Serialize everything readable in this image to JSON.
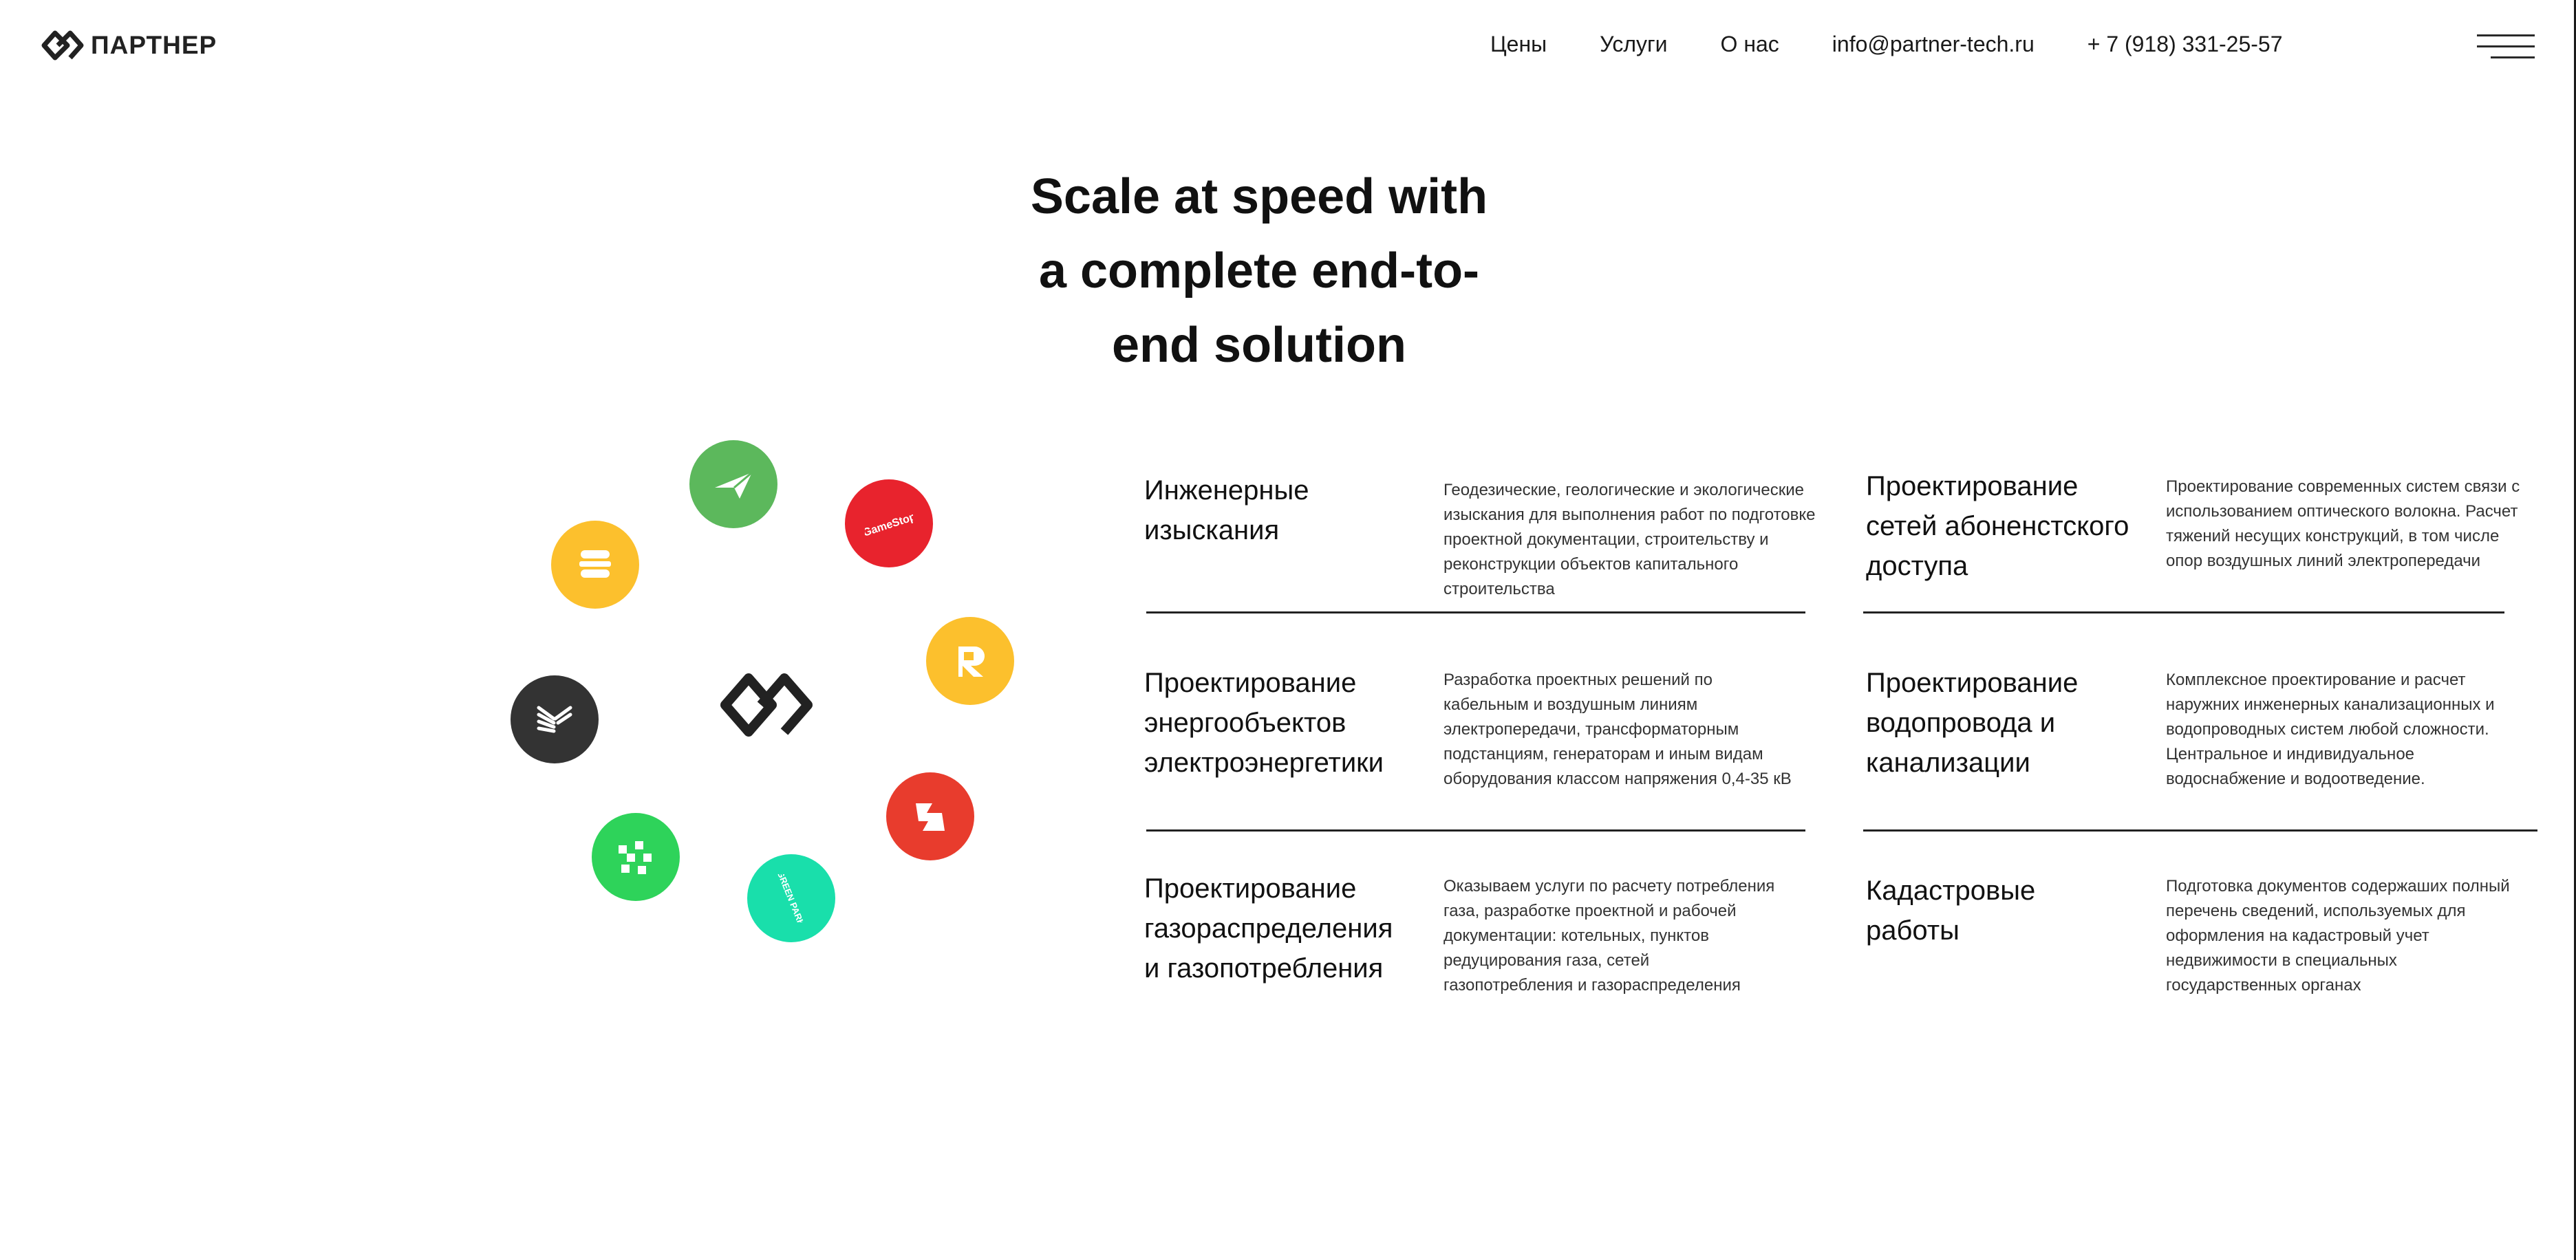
{
  "brand": {
    "name": "ПАРТНЕР"
  },
  "nav": {
    "items": [
      "Цены",
      "Услуги",
      "О нас",
      "info@partner-tech.ru",
      "+ 7 (918) 331-25-57"
    ]
  },
  "hero": {
    "lines": [
      "Scale at speed with",
      "a complete end-to-",
      "end solution"
    ]
  },
  "orbit": {
    "circles": [
      {
        "icon": "paper-plane-icon",
        "color": "#5cb85c"
      },
      {
        "icon": "gamestop-logo-icon",
        "color": "#e8232d",
        "text": "GameStop"
      },
      {
        "icon": "burger-logo-icon",
        "color": "#fcc02d"
      },
      {
        "icon": "r-logo-icon",
        "color": "#fcc02d"
      },
      {
        "icon": "wing-logo-icon",
        "color": "#333333"
      },
      {
        "icon": "m-logo-icon",
        "color": "#e83c2d"
      },
      {
        "icon": "checker-logo-icon",
        "color": "#2ed35a"
      },
      {
        "icon": "green-park-logo-icon",
        "color": "#19dfab",
        "text": "GREEN PARK"
      }
    ]
  },
  "services": [
    {
      "title": [
        "Инженерные",
        "изыскания"
      ],
      "desc": [
        "Геодезические, геологические и экологические",
        "изыскания для выполнения работ по подготовке",
        "проектной документации, строительству и",
        "реконструкции объектов капитального",
        "строительства"
      ]
    },
    {
      "title": [
        "Проектирование",
        "сетей абоненстского",
        "доступа"
      ],
      "desc": [
        "Проектирование современных систем связи с",
        "использованием оптического волокна. Расчет",
        "тяжений несущих конструкций, в том числе",
        "опор воздушных линий электропередачи"
      ]
    },
    {
      "title": [
        "Проектирование",
        "энергообъектов",
        "электроэнергетики"
      ],
      "desc": [
        "Разработка проектных решений по",
        "кабельным и воздушным линиям",
        "электропередачи, трансформаторным",
        "подстанциям, генераторам и иным видам",
        "оборудования классом напряжения 0,4-35 кВ"
      ]
    },
    {
      "title": [
        "Проектирование",
        "водопровода и",
        "канализации"
      ],
      "desc": [
        "Комплексное проектирование и расчет",
        "наружних инженерных канализационных и",
        "водопроводных систем любой сложности.",
        "Центральное и индивидуальное",
        "водоснабжение и водоотведение."
      ]
    },
    {
      "title": [
        "Проектирование",
        "газораспределения",
        "и газопотребления"
      ],
      "desc": [
        "Оказываем услуги по расчету потребления",
        "газа, разработке проектной и рабочей",
        "документации: котельных, пунктов",
        "редуцирования газа, сетей",
        "газопотребления и газораспределения"
      ]
    },
    {
      "title": [
        "Кадастровые",
        "работы"
      ],
      "desc": [
        "Подготовка документов содержаших полный",
        "перечень сведений, используемых для",
        "оформления на кадастровый учет",
        "недвижимости в специальных",
        "государственных органах"
      ]
    }
  ]
}
